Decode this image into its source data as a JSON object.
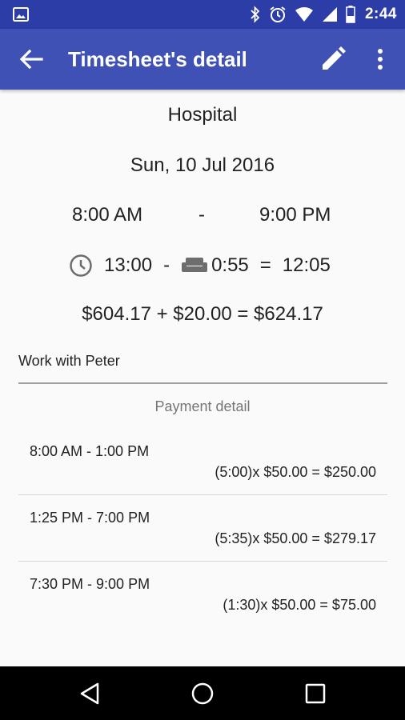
{
  "status_bar": {
    "time": "2:44",
    "icons": [
      "image-icon",
      "bluetooth-icon",
      "alarm-icon",
      "wifi-icon",
      "signal-icon",
      "battery-icon"
    ]
  },
  "app_bar": {
    "title": "Timesheet's detail",
    "icons": [
      "back-arrow-icon",
      "edit-pencil-icon",
      "more-vert-icon"
    ]
  },
  "timesheet": {
    "place": "Hospital",
    "date": "Sun, 10 Jul 2016",
    "start": "8:00 AM",
    "dash": "-",
    "end": "9:00 PM",
    "duration": "13:00",
    "minus": "-",
    "break": "0:55",
    "equals": "=",
    "worked": "12:05",
    "amount_line": "$604.17 + $20.00 = $624.17",
    "note": "Work with Peter"
  },
  "payment": {
    "title": "Payment detail",
    "rows": [
      {
        "range": "8:00 AM - 1:00 PM",
        "calc": "(5:00)x $50.00 = $250.00"
      },
      {
        "range": "1:25 PM - 7:00 PM",
        "calc": "(5:35)x $50.00 = $279.17"
      },
      {
        "range": "7:30 PM - 9:00 PM",
        "calc": "(1:30)x $50.00 = $75.00"
      }
    ]
  },
  "colors": {
    "status_bar": "#2c3da8",
    "app_bar": "#3f51b5",
    "background": "#fafafa",
    "nav_bar": "#000000"
  }
}
